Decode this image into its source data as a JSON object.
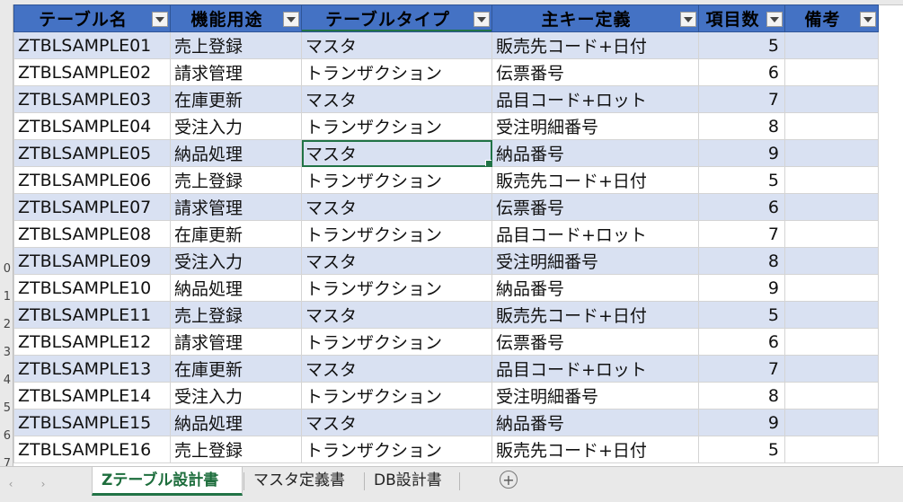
{
  "sheet": {
    "headers": [
      "テーブル名",
      "機能用途",
      "テーブルタイプ",
      "主キー定義",
      "項目数",
      "備考"
    ],
    "row_numbers": [
      "",
      "",
      "",
      "",
      "",
      "",
      "",
      "",
      "",
      "0",
      "1",
      "2",
      "3",
      "4",
      "5",
      "6",
      "7"
    ],
    "rows": [
      {
        "name": "ZTBLSAMPLE01",
        "use": "売上登録",
        "type": "マスタ",
        "pk": "販売先コード+日付",
        "count": "5",
        "note": ""
      },
      {
        "name": "ZTBLSAMPLE02",
        "use": "請求管理",
        "type": "トランザクション",
        "pk": "伝票番号",
        "count": "6",
        "note": ""
      },
      {
        "name": "ZTBLSAMPLE03",
        "use": "在庫更新",
        "type": "マスタ",
        "pk": "品目コード+ロット",
        "count": "7",
        "note": ""
      },
      {
        "name": "ZTBLSAMPLE04",
        "use": "受注入力",
        "type": "トランザクション",
        "pk": "受注明細番号",
        "count": "8",
        "note": ""
      },
      {
        "name": "ZTBLSAMPLE05",
        "use": "納品処理",
        "type": "マスタ",
        "pk": "納品番号",
        "count": "9",
        "note": ""
      },
      {
        "name": "ZTBLSAMPLE06",
        "use": "売上登録",
        "type": "トランザクション",
        "pk": "販売先コード+日付",
        "count": "5",
        "note": ""
      },
      {
        "name": "ZTBLSAMPLE07",
        "use": "請求管理",
        "type": "マスタ",
        "pk": "伝票番号",
        "count": "6",
        "note": ""
      },
      {
        "name": "ZTBLSAMPLE08",
        "use": "在庫更新",
        "type": "トランザクション",
        "pk": "品目コード+ロット",
        "count": "7",
        "note": ""
      },
      {
        "name": "ZTBLSAMPLE09",
        "use": "受注入力",
        "type": "マスタ",
        "pk": "受注明細番号",
        "count": "8",
        "note": ""
      },
      {
        "name": "ZTBLSAMPLE10",
        "use": "納品処理",
        "type": "トランザクション",
        "pk": "納品番号",
        "count": "9",
        "note": ""
      },
      {
        "name": "ZTBLSAMPLE11",
        "use": "売上登録",
        "type": "マスタ",
        "pk": "販売先コード+日付",
        "count": "5",
        "note": ""
      },
      {
        "name": "ZTBLSAMPLE12",
        "use": "請求管理",
        "type": "トランザクション",
        "pk": "伝票番号",
        "count": "6",
        "note": ""
      },
      {
        "name": "ZTBLSAMPLE13",
        "use": "在庫更新",
        "type": "マスタ",
        "pk": "品目コード+ロット",
        "count": "7",
        "note": ""
      },
      {
        "name": "ZTBLSAMPLE14",
        "use": "受注入力",
        "type": "トランザクション",
        "pk": "受注明細番号",
        "count": "8",
        "note": ""
      },
      {
        "name": "ZTBLSAMPLE15",
        "use": "納品処理",
        "type": "マスタ",
        "pk": "納品番号",
        "count": "9",
        "note": ""
      },
      {
        "name": "ZTBLSAMPLE16",
        "use": "売上登録",
        "type": "トランザクション",
        "pk": "販売先コード+日付",
        "count": "5",
        "note": ""
      }
    ]
  },
  "tabs": [
    {
      "label": "Zテーブル設計書",
      "active": true
    },
    {
      "label": "マスタ定義書",
      "active": false
    },
    {
      "label": "DB設計書",
      "active": false
    }
  ],
  "tabbar": {
    "prev_icon": "‹",
    "next_icon": "›",
    "add_icon": "+"
  },
  "colors": {
    "header_bg": "#4472c4",
    "band_bg": "#d9e1f2",
    "selection": "#217346"
  }
}
